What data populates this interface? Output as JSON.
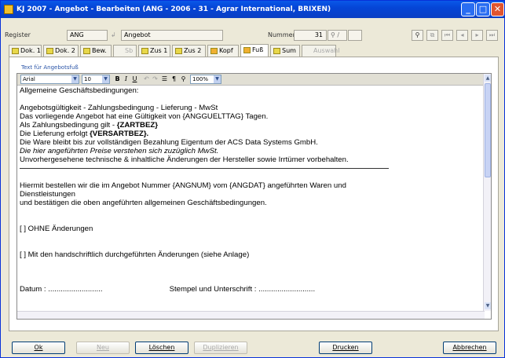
{
  "window": {
    "title": "KJ 2007 - Angebot - Bearbeiten (ANG - 2006 - 31 - Agrar International, BRIXEN)"
  },
  "header": {
    "register_label": "Register",
    "register_value": "ANG",
    "type_value": "Angebot",
    "nummer_label": "Nummer",
    "nummer_value": "31",
    "nummer_suffix": "/"
  },
  "tabs": [
    {
      "label": "Dok. 1",
      "enabled": true
    },
    {
      "label": "Dok. 2",
      "enabled": true
    },
    {
      "label": "Bew.",
      "enabled": true
    },
    {
      "label": "Sb",
      "enabled": false
    },
    {
      "label": "Zus 1",
      "enabled": true
    },
    {
      "label": "Zus 2",
      "enabled": true
    },
    {
      "label": "Kopf",
      "enabled": true
    },
    {
      "label": "Fuß",
      "enabled": true,
      "active": true
    },
    {
      "label": "Sum",
      "enabled": true
    },
    {
      "label": "Auswahl",
      "enabled": false
    }
  ],
  "editor": {
    "group_label": "Text für Angebotsfuß",
    "font": "Arial",
    "size": "10",
    "zoom": "100%",
    "lines": [
      "Allgemeine Geschäftsbedingungen:",
      "",
      "Angebotsgültigkeit - Zahlungsbedingung - Lieferung - MwSt",
      "Das vorliegende Angebot hat eine Gültigkeit von {ANGGUELTTAG} Tagen.",
      "Als Zahlungsbedingung gilt - {ZARTBEZ}",
      "Die Lieferung erfolgt {VERSARTBEZ}.",
      "Die Ware bleibt bis zur vollständigen Bezahlung Eigentum der ACS Data Systems GmbH.",
      "Die hier angeführten Preise verstehen sich zuzüglich MwSt.",
      "Unvorhergesehene technische & inhaltliche Änderungen der Hersteller sowie Irrtümer vorbehalten.",
      "",
      "",
      "Hiermit bestellen wir die im Angebot Nummer {ANGNUM} vom {ANGDAT} angeführten Waren und",
      "Dienstleistungen",
      "und bestätigen die oben angeführten allgemeinen Geschäftsbedingungen.",
      "",
      "",
      "[ ] OHNE Änderungen",
      "",
      "",
      "[ ] Mit den handschriftlich durchgeführten Änderungen (siehe Anlage)",
      "",
      "",
      "",
      "Datum : ..........................",
      "Stempel und Unterschrift : ..........................."
    ]
  },
  "buttons": {
    "ok": "Ok",
    "neu": "Neu",
    "loeschen": "Löschen",
    "duplizieren": "Duplizieren",
    "drucken": "Drucken",
    "abbrechen": "Abbrechen"
  }
}
